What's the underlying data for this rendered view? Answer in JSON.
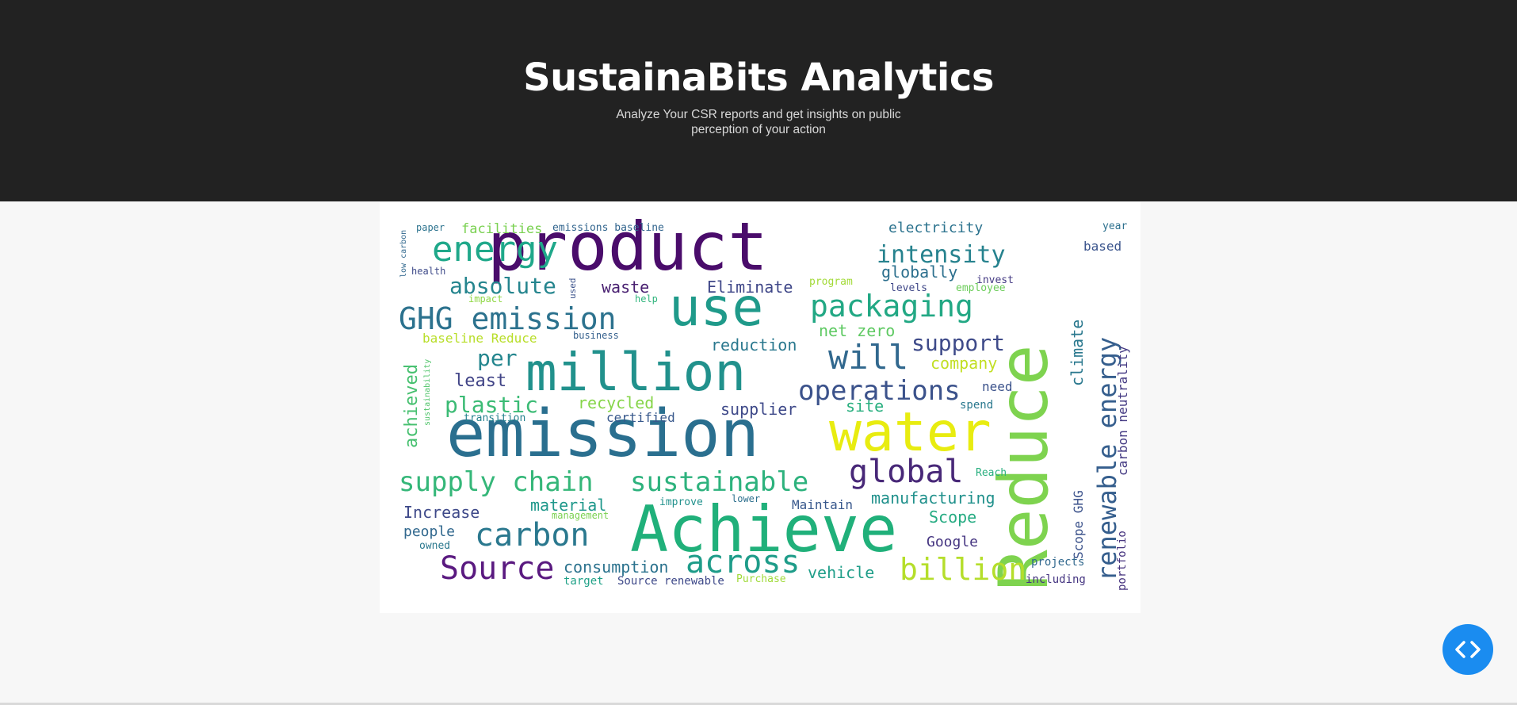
{
  "header": {
    "title": "SustainaBits Analytics",
    "subtitle": "Analyze Your CSR reports and get insights on public perception of your action"
  },
  "wordcloud": {
    "words": [
      {
        "text": "product",
        "color": "#4a0c6b"
      },
      {
        "text": "emission",
        "color": "#2a6f8f"
      },
      {
        "text": "million",
        "color": "#21918c"
      },
      {
        "text": "use",
        "color": "#1f9a8a"
      },
      {
        "text": "Achieve",
        "color": "#20b07a"
      },
      {
        "text": "water",
        "color": "#e8ec10"
      },
      {
        "text": "Reduce",
        "color": "#7ed34f"
      },
      {
        "text": "energy",
        "color": "#1fa88a"
      },
      {
        "text": "GHG emission",
        "color": "#2c728e"
      },
      {
        "text": "packaging",
        "color": "#22a884"
      },
      {
        "text": "intensity",
        "color": "#26828e"
      },
      {
        "text": "global",
        "color": "#482878"
      },
      {
        "text": "operations",
        "color": "#3b528b"
      },
      {
        "text": "will",
        "color": "#31688e"
      },
      {
        "text": "carbon",
        "color": "#2a788e"
      },
      {
        "text": "supply chain",
        "color": "#35b779"
      },
      {
        "text": "sustainable",
        "color": "#2db27d"
      },
      {
        "text": "Source",
        "color": "#5a1a80"
      },
      {
        "text": "across",
        "color": "#1e9c89"
      },
      {
        "text": "billion",
        "color": "#b5de2b"
      },
      {
        "text": "renewable energy",
        "color": "#355e8d"
      },
      {
        "text": "absolute",
        "color": "#25858e"
      },
      {
        "text": "plastic",
        "color": "#3bbb75"
      },
      {
        "text": "support",
        "color": "#3e4a89"
      },
      {
        "text": "electricity",
        "color": "#2c738e"
      },
      {
        "text": "climate",
        "color": "#2a788e"
      },
      {
        "text": "carbon neutrality",
        "color": "#443a83"
      },
      {
        "text": "Scope GHG",
        "color": "#3b528b"
      },
      {
        "text": "waste",
        "color": "#481f70"
      },
      {
        "text": "Eliminate",
        "color": "#3f4788"
      },
      {
        "text": "globally",
        "color": "#2d708e"
      },
      {
        "text": "facilities",
        "color": "#7ad151"
      },
      {
        "text": "emissions baseline",
        "color": "#32658e"
      },
      {
        "text": "net zero",
        "color": "#5ec962"
      },
      {
        "text": "reduction",
        "color": "#2a788e"
      },
      {
        "text": "company",
        "color": "#c2df23"
      },
      {
        "text": "per",
        "color": "#24868e"
      },
      {
        "text": "least",
        "color": "#414487"
      },
      {
        "text": "achieved",
        "color": "#46c06f"
      },
      {
        "text": "recycled",
        "color": "#86d549"
      },
      {
        "text": "supplier",
        "color": "#3e4989"
      },
      {
        "text": "site",
        "color": "#29af7f"
      },
      {
        "text": "certified",
        "color": "#38588c"
      },
      {
        "text": "material",
        "color": "#1f988b"
      },
      {
        "text": "manufacturing",
        "color": "#21918c"
      },
      {
        "text": "Increase",
        "color": "#3e4989"
      },
      {
        "text": "people",
        "color": "#31688e"
      },
      {
        "text": "Scope",
        "color": "#25ab82"
      },
      {
        "text": "Google",
        "color": "#453581"
      },
      {
        "text": "consumption",
        "color": "#2c738e"
      },
      {
        "text": "vehicle",
        "color": "#1f9e89"
      },
      {
        "text": "projects",
        "color": "#31688e"
      },
      {
        "text": "including",
        "color": "#453581"
      },
      {
        "text": "Maintain",
        "color": "#38588c"
      },
      {
        "text": "Source renewable",
        "color": "#3e4989"
      },
      {
        "text": "target",
        "color": "#1fa187"
      },
      {
        "text": "Purchase",
        "color": "#a0da39"
      },
      {
        "text": "portfolio",
        "color": "#46337e"
      },
      {
        "text": "based",
        "color": "#3a548c"
      },
      {
        "text": "year",
        "color": "#2d708e"
      },
      {
        "text": "invest",
        "color": "#443a83"
      },
      {
        "text": "need",
        "color": "#3b528b"
      },
      {
        "text": "spend",
        "color": "#2a788e"
      },
      {
        "text": "paper",
        "color": "#2c738e"
      },
      {
        "text": "health",
        "color": "#3e4a89"
      },
      {
        "text": "low carbon",
        "color": "#31688e"
      },
      {
        "text": "baseline Reduce",
        "color": "#b8de29"
      },
      {
        "text": "business",
        "color": "#35608d"
      },
      {
        "text": "impact",
        "color": "#8fd744"
      },
      {
        "text": "help",
        "color": "#2fb47c"
      },
      {
        "text": "levels",
        "color": "#3f4788"
      },
      {
        "text": "employee",
        "color": "#6ccd5a"
      },
      {
        "text": "program",
        "color": "#a2da37"
      },
      {
        "text": "used",
        "color": "#3b528b"
      },
      {
        "text": "transition",
        "color": "#26828e"
      },
      {
        "text": "owned",
        "color": "#2a788e"
      },
      {
        "text": "improve",
        "color": "#21918c"
      },
      {
        "text": "lower",
        "color": "#2d708e"
      },
      {
        "text": "management",
        "color": "#7ad151"
      },
      {
        "text": "sustainability",
        "color": "#50c46a"
      },
      {
        "text": "Reach",
        "color": "#29af7f"
      }
    ]
  },
  "fab": {
    "icon": "code-icon"
  }
}
